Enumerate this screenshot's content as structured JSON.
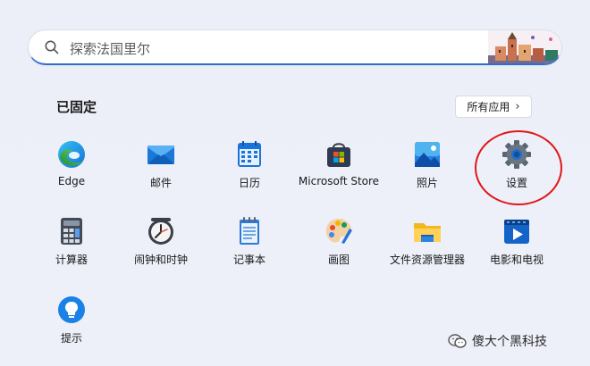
{
  "search": {
    "placeholder": "探索法国里尔"
  },
  "pinned": {
    "title": "已固定",
    "all_apps_label": "所有应用"
  },
  "apps": [
    {
      "label": "Edge",
      "icon": "edge-icon"
    },
    {
      "label": "邮件",
      "icon": "mail-icon"
    },
    {
      "label": "日历",
      "icon": "calendar-icon"
    },
    {
      "label": "Microsoft Store",
      "icon": "store-icon"
    },
    {
      "label": "照片",
      "icon": "photos-icon"
    },
    {
      "label": "设置",
      "icon": "settings-gear-icon"
    },
    {
      "label": "计算器",
      "icon": "calculator-icon"
    },
    {
      "label": "闹钟和时钟",
      "icon": "clock-icon"
    },
    {
      "label": "记事本",
      "icon": "notepad-icon"
    },
    {
      "label": "画图",
      "icon": "paint-icon"
    },
    {
      "label": "文件资源管理器",
      "icon": "folder-icon"
    },
    {
      "label": "电影和电视",
      "icon": "movies-icon"
    },
    {
      "label": "提示",
      "icon": "tips-icon"
    }
  ],
  "watermark": {
    "text": "傻大个黑科技"
  },
  "colors": {
    "accent": "#2f6fd0",
    "annotation": "#e01818"
  }
}
